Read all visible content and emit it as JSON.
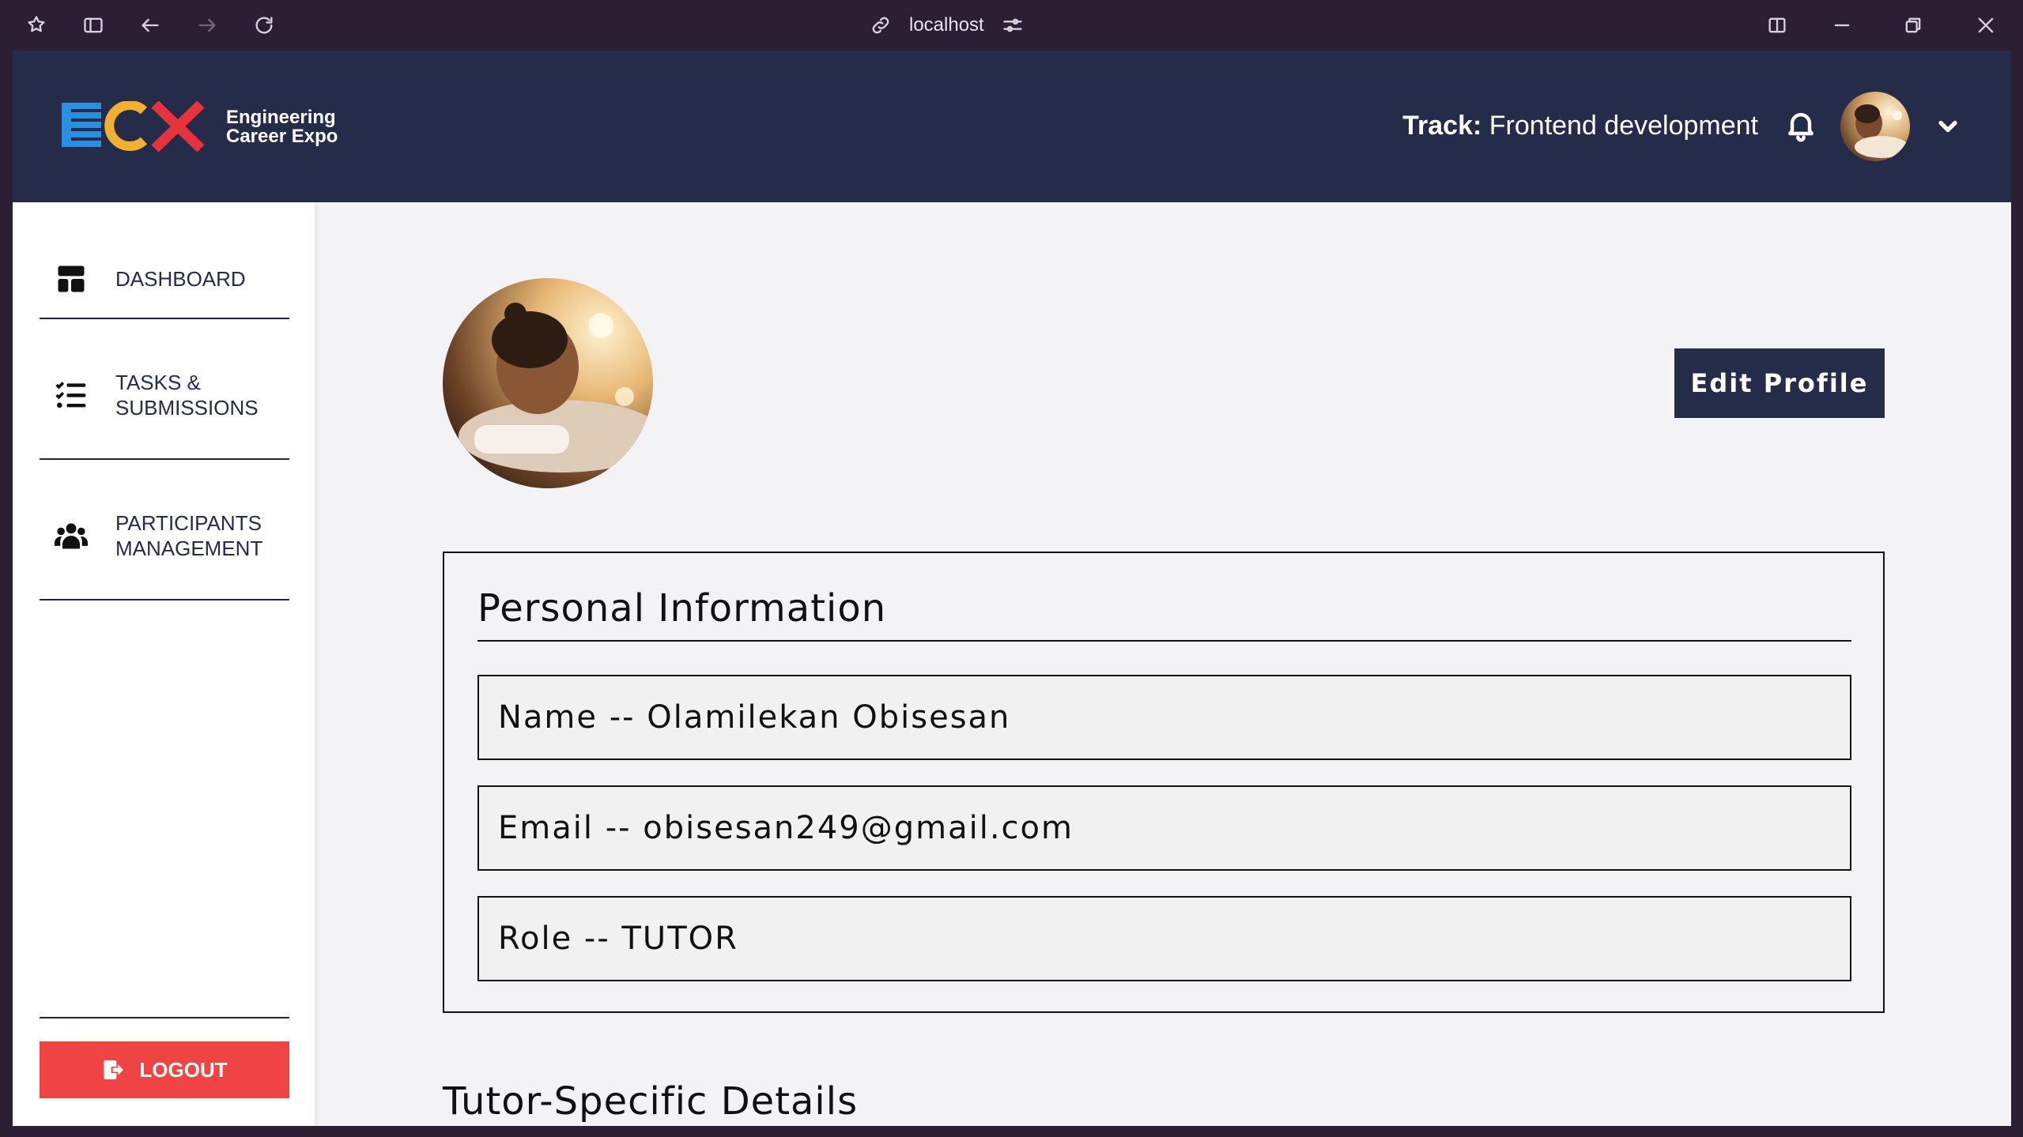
{
  "browser": {
    "url": "localhost"
  },
  "header": {
    "logo_text_line1": "Engineering",
    "logo_text_line2": "Career Expo",
    "track_label": "Track:",
    "track_value": "Frontend development"
  },
  "sidebar": {
    "items": [
      {
        "label": "DASHBOARD",
        "icon": "dashboard-icon"
      },
      {
        "label": "TASKS &\nSUBMISSIONS",
        "icon": "task-list-icon"
      },
      {
        "label": "PARTICIPANTS\nMANAGEMENT",
        "icon": "users-icon"
      }
    ],
    "logout_label": "LOGOUT"
  },
  "main": {
    "edit_profile_label": "Edit Profile",
    "personal_info": {
      "title": "Personal Information",
      "name": "Name -- Olamilekan Obisesan",
      "email": "Email -- obisesan249@gmail.com",
      "role": "Role -- TUTOR"
    },
    "tutor_section_title": "Tutor-Specific Details"
  },
  "colors": {
    "header_bg": "#252c4a",
    "logout_bg": "#f04444",
    "logo_blue": "#2a8fe0",
    "logo_yellow": "#f2b02e",
    "logo_red": "#e8333a"
  }
}
